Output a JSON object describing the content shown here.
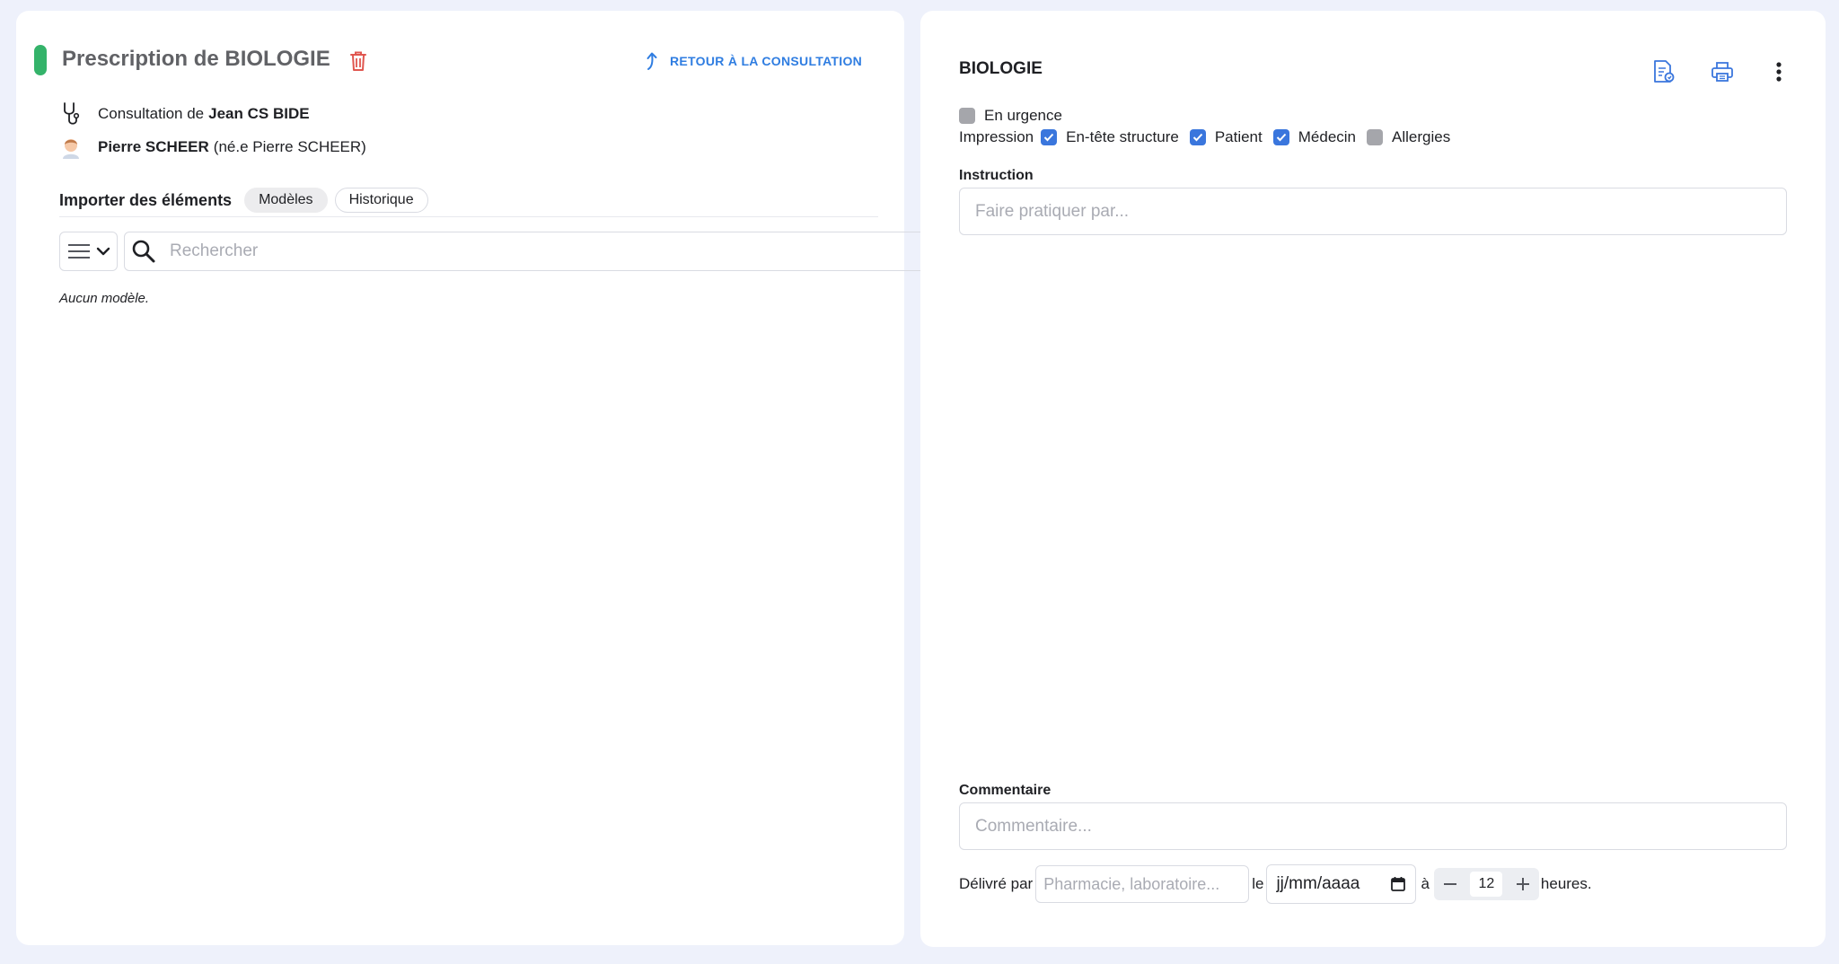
{
  "colors": {
    "accent": "#2f7de1",
    "status_green": "#34b36a",
    "danger": "#e0564f",
    "checkbox_on": "#3a76dd"
  },
  "left": {
    "title": "Prescription de BIOLOGIE",
    "return_label": "RETOUR À LA CONSULTATION",
    "consultation": {
      "prefix": "Consultation de",
      "name": "Jean CS BIDE"
    },
    "patient": {
      "name": "Pierre SCHEER",
      "birth_name": "(né.e Pierre SCHEER)"
    },
    "import": {
      "title": "Importer des éléments",
      "tabs": [
        {
          "label": "Modèles",
          "active": true
        },
        {
          "label": "Historique",
          "active": false
        }
      ]
    },
    "search": {
      "placeholder": "Rechercher",
      "value": ""
    },
    "empty_text": "Aucun modèle."
  },
  "right": {
    "title": "BIOLOGIE",
    "urgent": {
      "label": "En urgence",
      "checked": false
    },
    "print_options": {
      "label": "Impression",
      "items": [
        {
          "label": "En-tête structure",
          "checked": true
        },
        {
          "label": "Patient",
          "checked": true
        },
        {
          "label": "Médecin",
          "checked": true
        },
        {
          "label": "Allergies",
          "checked": false
        }
      ]
    },
    "instruction": {
      "label": "Instruction",
      "placeholder": "Faire pratiquer par..."
    },
    "comment": {
      "label": "Commentaire",
      "placeholder": "Commentaire..."
    },
    "delivery": {
      "prefix": "Délivré par",
      "placeholder": "Pharmacie, laboratoire...",
      "le": "le",
      "date_placeholder": "jj/mm/aaaa",
      "a": "à",
      "hours_value": "12",
      "suffix": "heures."
    }
  }
}
